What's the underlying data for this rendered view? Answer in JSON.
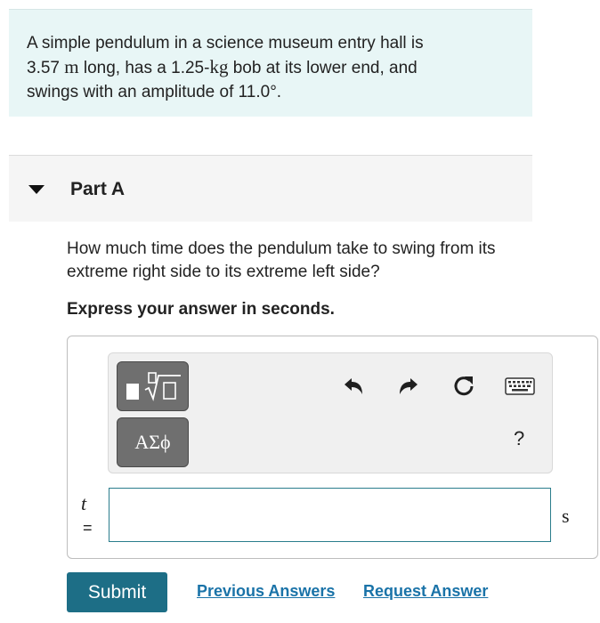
{
  "problem": {
    "line1": "A simple pendulum in a science museum entry hall is",
    "length_value": "3.57",
    "length_unit": "m",
    "line2_mid": " long, has a 1.25-",
    "mass_unit": "kg",
    "line2_end": " bob at its lower end, and",
    "line3": "swings with an amplitude of 11.0°."
  },
  "part": {
    "title": "Part A"
  },
  "question": {
    "text": "How much time does the pendulum take to swing from its extreme right side to its extreme left side?",
    "instruction": "Express your answer in seconds."
  },
  "toolbar": {
    "greek_label": "ΑΣϕ",
    "help_label": "?",
    "icons": [
      "templates-icon",
      "undo-icon",
      "redo-icon",
      "reset-icon",
      "keyboard-icon"
    ]
  },
  "answer": {
    "variable": "t",
    "equals": "=",
    "value": "",
    "unit": "s"
  },
  "actions": {
    "submit_label": "Submit",
    "previous_answers_label": "Previous Answers",
    "request_answer_label": "Request Answer"
  },
  "colors": {
    "problem_bg": "#e8f6f6",
    "submit_bg": "#1d6e86",
    "link": "#1a73a8",
    "input_border": "#2a7d8c"
  }
}
